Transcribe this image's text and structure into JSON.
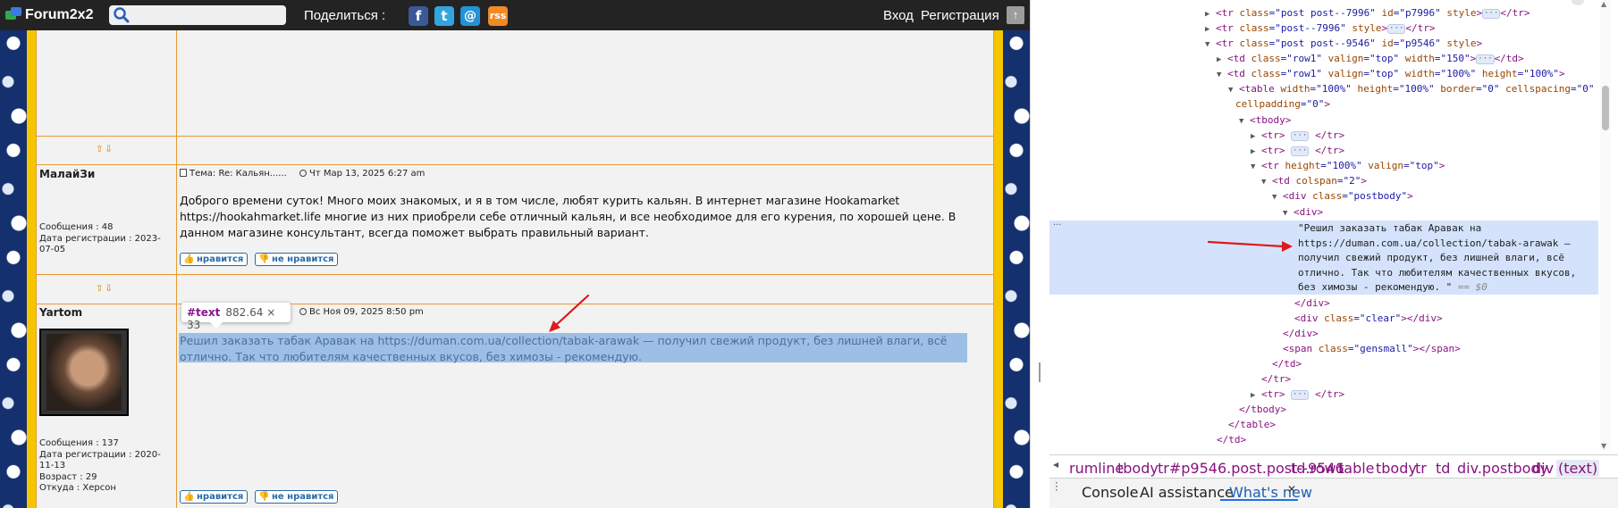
{
  "forum": {
    "topbar": {
      "brand": "Forum2x2",
      "search_placeholder": "",
      "share_label": "Поделиться :",
      "social": {
        "facebook": "f",
        "twitter": "t",
        "email": "@",
        "rss": "rss"
      },
      "login": "Вход",
      "register": "Регистрация",
      "scroll_top": "↑"
    },
    "arrows": "⇧⇩",
    "posts": [
      {
        "author": "МалайЗи",
        "stats": [
          "Сообщения : 48",
          "Дата регистрации : 2023-07-05"
        ],
        "subject": "Тема: Re: Кальян......",
        "date": "Чт Мар 13, 2025 6:27 am",
        "body": "Доброго времени суток! Много моих знакомых, и я в том числе, любят курить кальян. В интернет магазине Hookamarket https://hookahmarket.life многие из них приобрели себе отличный кальян, и все необходимое для его курения, по хорошей цене. В данном магазине консультант, всегда поможет выбрать правильный вариант.",
        "like": "нравится",
        "dislike": "не нравится"
      },
      {
        "author": "Yartom",
        "stats": [
          "Сообщения : 137",
          "Дата регистрации : 2020-11-13",
          "Возраст : 29",
          "Откуда : Херсон"
        ],
        "subject": "",
        "date": "Вс Ноя 09, 2025 8:50 pm",
        "body": "Решил заказать табак Аравак на https://duman.com.ua/collection/tabak-arawak — получил свежий продукт, без лишней влаги, всё отлично. Так что любителям качественных вкусов, без химозы - рекомендую.",
        "like": "нравится",
        "dislike": "не нравится"
      }
    ],
    "tooltip": {
      "tag": "#text",
      "size": "882.64 × 33"
    }
  },
  "devtools": {
    "selected_text": "\"Решил заказать табак Аравак на https://duman.com.ua/collection/tabak-arawak — получил свежий продукт, без лишней влаги, всё отлично. Так что любителям качественных вкусов, без химозы - рекомендую. \"",
    "dollar0": "== $0",
    "breadcrumbs": [
      "rumline",
      "tbody",
      "tr#p9546.post.post--9546",
      "td.row1",
      "table",
      "tbody",
      "tr",
      "td",
      "div.postbody",
      "div",
      "(text)"
    ],
    "drawer_tabs": [
      "Console",
      "AI assistance",
      "What's new"
    ]
  },
  "colors": {
    "forum_yellow": "#f6c500",
    "forum_border": "#e79a32",
    "selection_blue": "#9dbfe6",
    "devtools_selected": "#d4e3fb",
    "annotation_red": "#e0191b"
  }
}
